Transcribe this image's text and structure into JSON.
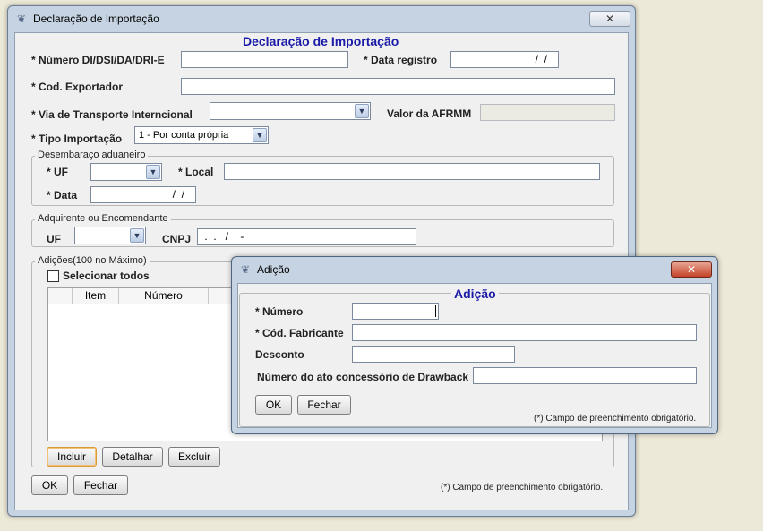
{
  "main_window": {
    "title": "Declaração de Importação",
    "close_glyph": "✕",
    "group_title": "Declaração de Importação",
    "labels": {
      "numero_di": "* Número DI/DSI/DA/DRI-E",
      "data_registro": "* Data registro",
      "cod_exportador": "* Cod. Exportador",
      "via_transporte": "* Via de Transporte Interncional",
      "valor_afrmm": "Valor da AFRMM",
      "tipo_importacao": "* Tipo Importação"
    },
    "values": {
      "numero_di": "",
      "data_registro": "       /  /",
      "cod_exportador": "",
      "via_transporte": "",
      "valor_afrmm": "",
      "tipo_importacao": "1 - Por conta própria"
    },
    "desembaraco": {
      "legend": "Desembaraço aduaneiro",
      "uf_label": "* UF",
      "uf_value": "",
      "local_label": "* Local",
      "local_value": "",
      "data_label": "* Data",
      "data_value": "       /  /"
    },
    "adquirente": {
      "legend": "Adquirente ou Encomendante",
      "uf_label": "UF",
      "uf_value": "",
      "cnpj_label": "CNPJ",
      "cnpj_value": " .  .   /    -"
    },
    "adicoes": {
      "legend": "Adições(100 no Máximo)",
      "select_all": "Selecionar todos",
      "columns": [
        "Item",
        "Número"
      ],
      "buttons": {
        "incluir": "Incluir",
        "detalhar": "Detalhar",
        "excluir": "Excluir"
      }
    },
    "buttons": {
      "ok": "OK",
      "fechar": "Fechar"
    },
    "required_note": "(*) Campo de preenchimento obrigatório."
  },
  "dialog": {
    "title": "Adição",
    "close_glyph": "✕",
    "group_title": "Adição",
    "labels": {
      "numero": "* Número",
      "cod_fabricante": "* Cód. Fabricante",
      "desconto": "Desconto",
      "ato_drawback": "Número do ato concessório de Drawback"
    },
    "values": {
      "numero": "",
      "cod_fabricante": "",
      "desconto": "",
      "ato_drawback": ""
    },
    "buttons": {
      "ok": "OK",
      "fechar": "Fechar"
    },
    "required_note": "(*) Campo de preenchimento obrigatório."
  },
  "icons": {
    "app_logo": "app-logo-icon",
    "dropdown": "chevron-down-icon",
    "close": "close-icon"
  }
}
